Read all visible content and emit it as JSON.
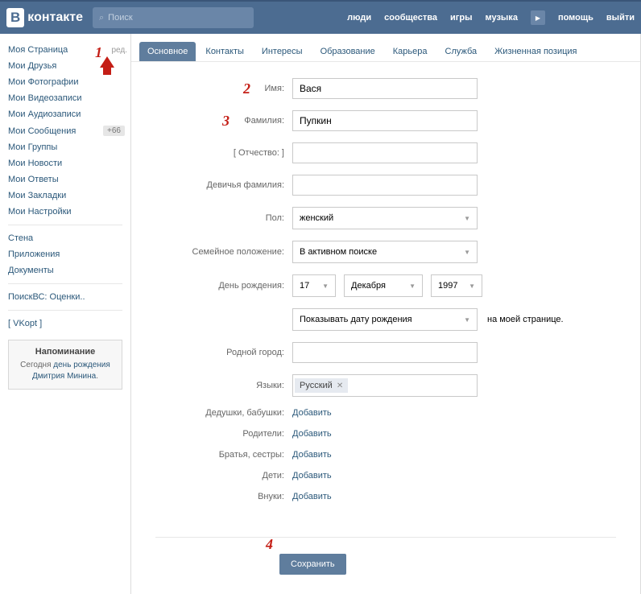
{
  "logo_text": "контакте",
  "search_placeholder": "Поиск",
  "nav": {
    "people": "люди",
    "communities": "сообщества",
    "games": "игры",
    "music": "музыка",
    "help": "помощь",
    "exit": "выйти"
  },
  "sidebar": {
    "items": [
      {
        "label": "Моя Страница",
        "extra": "ред."
      },
      {
        "label": "Мои Друзья"
      },
      {
        "label": "Мои Фотографии"
      },
      {
        "label": "Мои Видеозаписи"
      },
      {
        "label": "Мои Аудиозаписи"
      },
      {
        "label": "Мои Сообщения",
        "badge": "+66"
      },
      {
        "label": "Мои Группы"
      },
      {
        "label": "Мои Новости"
      },
      {
        "label": "Мои Ответы"
      },
      {
        "label": "Мои Закладки"
      },
      {
        "label": "Мои Настройки"
      }
    ],
    "group2": [
      {
        "label": "Стена"
      },
      {
        "label": "Приложения"
      },
      {
        "label": "Документы"
      }
    ],
    "group3": [
      {
        "label": "ПоискВС: Оценки.."
      }
    ],
    "group4": [
      {
        "label": "[ VKopt ]"
      }
    ]
  },
  "reminder": {
    "title": "Напоминание",
    "prefix": "Сегодня ",
    "mid": "день рождения ",
    "name": "Дмитрия Минина",
    "suffix": "."
  },
  "tabs": [
    "Основное",
    "Контакты",
    "Интересы",
    "Образование",
    "Карьера",
    "Служба",
    "Жизненная позиция"
  ],
  "form": {
    "name_label": "Имя:",
    "name_value": "Вася",
    "surname_label": "Фамилия:",
    "surname_value": "Пупкин",
    "patronym_label": "[ Отчество: ]",
    "maiden_label": "Девичья фамилия:",
    "gender_label": "Пол:",
    "gender_value": "женский",
    "status_label": "Семейное положение:",
    "status_value": "В активном поиске",
    "bday_label": "День рождения:",
    "bday_day": "17",
    "bday_month": "Декабря",
    "bday_year": "1997",
    "bday_show": "Показывать дату рождения",
    "bday_aside": "на моей странице.",
    "hometown_label": "Родной город:",
    "lang_label": "Языки:",
    "lang_tag": "Русский",
    "grandparents_label": "Дедушки, бабушки:",
    "parents_label": "Родители:",
    "siblings_label": "Братья, сестры:",
    "children_label": "Дети:",
    "grandchildren_label": "Внуки:",
    "add_text": "Добавить"
  },
  "save_label": "Сохранить",
  "annot": {
    "a1": "1",
    "a2": "2",
    "a3": "3",
    "a4": "4"
  }
}
